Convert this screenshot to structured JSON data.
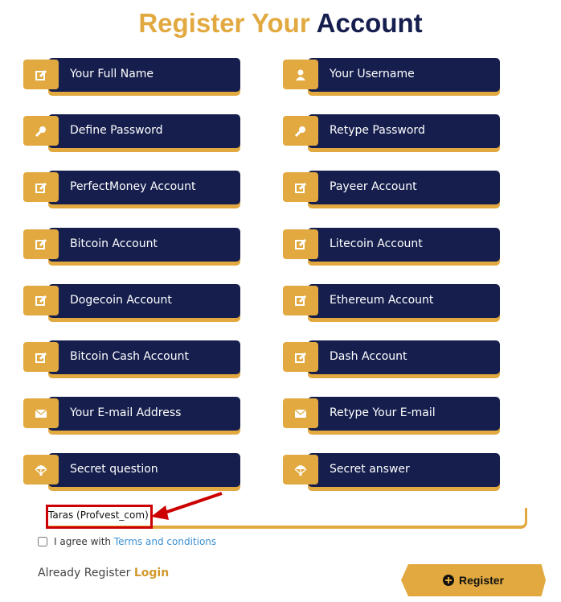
{
  "title": {
    "part1": "Register Your",
    "part2": "Account"
  },
  "fields": [
    {
      "label": "Your Full Name",
      "icon": "edit-icon"
    },
    {
      "label": "Your Username",
      "icon": "user-icon"
    },
    {
      "label": "Define Password",
      "icon": "key-icon"
    },
    {
      "label": "Retype Password",
      "icon": "key-icon"
    },
    {
      "label": "PerfectMoney Account",
      "icon": "edit-icon"
    },
    {
      "label": "Payeer Account",
      "icon": "edit-icon"
    },
    {
      "label": "Bitcoin Account",
      "icon": "edit-icon"
    },
    {
      "label": "Litecoin Account",
      "icon": "edit-icon"
    },
    {
      "label": "Dogecoin Account",
      "icon": "edit-icon"
    },
    {
      "label": "Ethereum Account",
      "icon": "edit-icon"
    },
    {
      "label": "Bitcoin Cash Account",
      "icon": "edit-icon"
    },
    {
      "label": "Dash Account",
      "icon": "edit-icon"
    },
    {
      "label": "Your E-mail Address",
      "icon": "envelope-icon"
    },
    {
      "label": "Retype Your E-mail",
      "icon": "envelope-icon"
    },
    {
      "label": "Secret question",
      "icon": "parachute-icon"
    },
    {
      "label": "Secret answer",
      "icon": "parachute-icon"
    }
  ],
  "answer_value": "Taras (Profvest_com)",
  "agree": {
    "text": "I agree with",
    "link": "Terms and conditions"
  },
  "login": {
    "text": "Already Register",
    "link": "Login"
  },
  "register_button": "Register",
  "colors": {
    "gold": "#E1A93F",
    "navy": "#151E4D",
    "annotation": "#CC0000"
  }
}
